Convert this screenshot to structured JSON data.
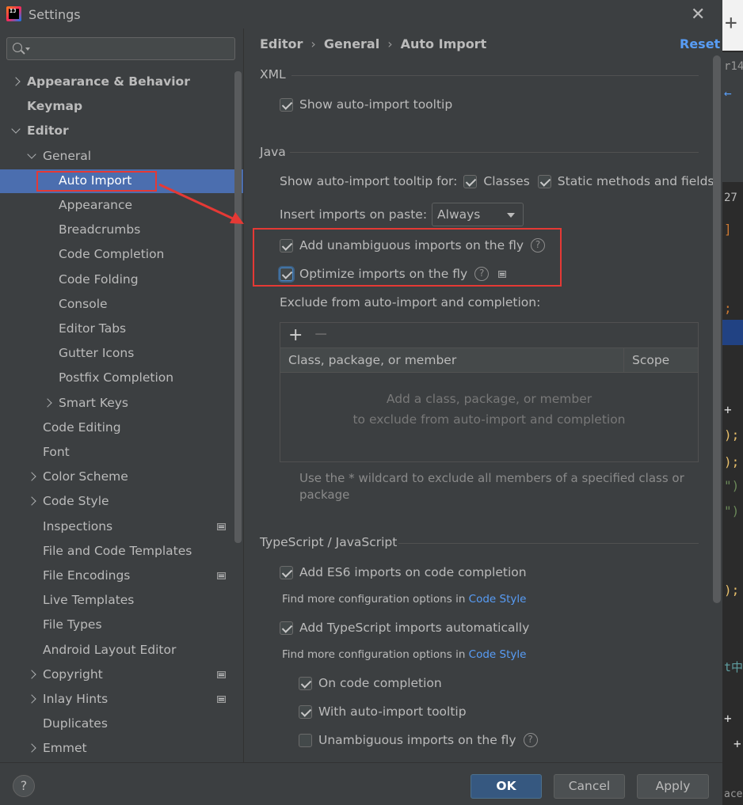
{
  "window": {
    "title": "Settings",
    "icon_name": "intellij-logo-icon",
    "icon_text": "IJ"
  },
  "sidebar": {
    "search_placeholder": "",
    "items": [
      {
        "label": "Appearance & Behavior",
        "bold": true,
        "level": 0,
        "chevron": "right"
      },
      {
        "label": "Keymap",
        "bold": true,
        "level": 0,
        "chevron": ""
      },
      {
        "label": "Editor",
        "bold": true,
        "level": 0,
        "chevron": "down"
      },
      {
        "label": "General",
        "level": 1,
        "chevron": "down"
      },
      {
        "label": "Auto Import",
        "level": 2,
        "selected": true
      },
      {
        "label": "Appearance",
        "level": 2
      },
      {
        "label": "Breadcrumbs",
        "level": 2
      },
      {
        "label": "Code Completion",
        "level": 2
      },
      {
        "label": "Code Folding",
        "level": 2
      },
      {
        "label": "Console",
        "level": 2
      },
      {
        "label": "Editor Tabs",
        "level": 2
      },
      {
        "label": "Gutter Icons",
        "level": 2
      },
      {
        "label": "Postfix Completion",
        "level": 2
      },
      {
        "label": "Smart Keys",
        "level": 2,
        "chevron": "right"
      },
      {
        "label": "Code Editing",
        "level": 1
      },
      {
        "label": "Font",
        "level": 1
      },
      {
        "label": "Color Scheme",
        "level": 1,
        "chevron": "right"
      },
      {
        "label": "Code Style",
        "level": 1,
        "chevron": "right"
      },
      {
        "label": "Inspections",
        "level": 1,
        "module_icon": true
      },
      {
        "label": "File and Code Templates",
        "level": 1
      },
      {
        "label": "File Encodings",
        "level": 1,
        "module_icon": true
      },
      {
        "label": "Live Templates",
        "level": 1
      },
      {
        "label": "File Types",
        "level": 1
      },
      {
        "label": "Android Layout Editor",
        "level": 1
      },
      {
        "label": "Copyright",
        "level": 1,
        "chevron": "right",
        "module_icon": true
      },
      {
        "label": "Inlay Hints",
        "level": 1,
        "chevron": "right",
        "module_icon": true
      },
      {
        "label": "Duplicates",
        "level": 1
      },
      {
        "label": "Emmet",
        "level": 1,
        "chevron": "right"
      }
    ]
  },
  "header": {
    "breadcrumb": [
      "Editor",
      "General",
      "Auto Import"
    ],
    "reset_label": "Reset"
  },
  "xml": {
    "title": "XML",
    "show_tooltip": {
      "label": "Show auto-import tooltip",
      "checked": true
    }
  },
  "java": {
    "title": "Java",
    "tooltip_for_label": "Show auto-import tooltip for:",
    "classes": {
      "label": "Classes",
      "checked": true
    },
    "static_methods": {
      "label": "Static methods and fields",
      "checked": true
    },
    "insert_on_paste_label": "Insert imports on paste:",
    "insert_on_paste_value": "Always",
    "add_unambiguous": {
      "label": "Add unambiguous imports on the fly",
      "checked": true
    },
    "optimize_imports": {
      "label": "Optimize imports on the fly",
      "checked": true
    },
    "exclude_label": "Exclude from auto-import and completion:",
    "table": {
      "add_icon": "+",
      "remove_icon": "−",
      "columns": [
        "Class, package, or member",
        "Scope"
      ],
      "empty_line1": "Add a class, package, or member",
      "empty_line2": "to exclude from auto-import and completion"
    },
    "hint": "Use the * wildcard to exclude all members of a specified class or package"
  },
  "typescript": {
    "title": "TypeScript / JavaScript",
    "add_es6": {
      "label": "Add ES6 imports on code completion",
      "checked": true
    },
    "note1_prefix": "Find more configuration options in ",
    "note1_link": "Code Style",
    "add_ts_auto": {
      "label": "Add TypeScript imports automatically",
      "checked": true
    },
    "note2_prefix": "Find more configuration options in ",
    "note2_link": "Code Style",
    "on_code_completion": {
      "label": "On code completion",
      "checked": true
    },
    "with_tooltip": {
      "label": "With auto-import tooltip",
      "checked": true
    },
    "unambiguous_on_fly": {
      "label": "Unambiguous imports on the fly",
      "checked": false
    }
  },
  "footer": {
    "help_label": "?",
    "ok_label": "OK",
    "cancel_label": "Cancel",
    "apply_label": "Apply"
  },
  "background_editor": {
    "tab_plus": "+",
    "snippets": [
      "r14",
      "←",
      "27",
      "]",
      ";",
      "+",
      ");",
      ");",
      "\")",
      "\")",
      ");",
      "t中",
      "+",
      "+",
      "ace"
    ]
  },
  "colors": {
    "accent_link": "#589df6",
    "selection": "#4b6eaf",
    "primary_button": "#365880",
    "annotation_red": "#e53935"
  }
}
